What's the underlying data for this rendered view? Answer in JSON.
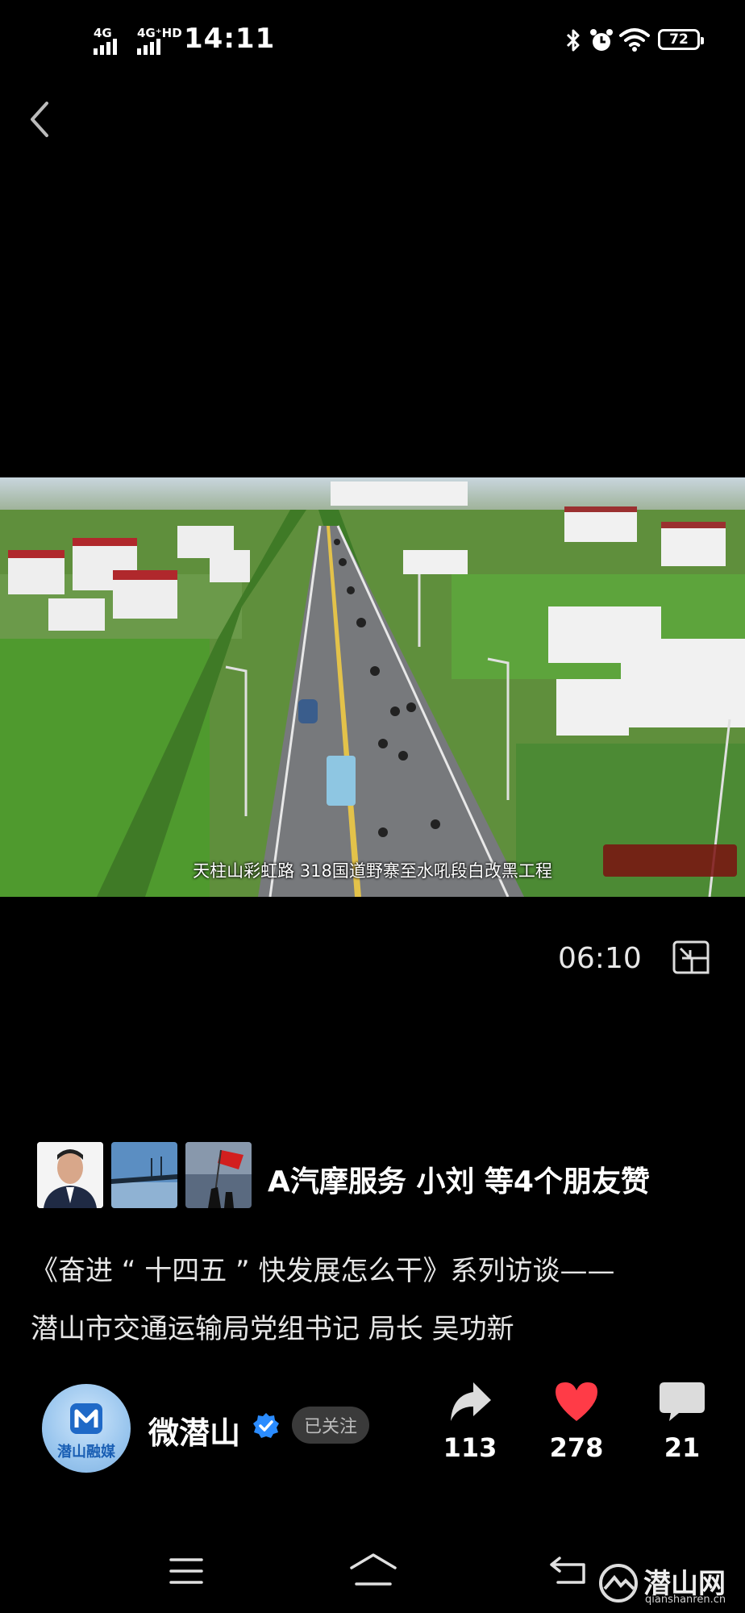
{
  "status_bar": {
    "signal1_label": "4G",
    "signal2_label": "4G⁺HD",
    "time": "14:11",
    "battery": "72"
  },
  "video": {
    "subtitle": "天柱山彩虹路   318国道野寨至水吼段白改黑工程",
    "duration": "06:10"
  },
  "likes": {
    "text": "A汽摩服务  小刘  等4个朋友赞"
  },
  "post": {
    "title_line1": "《奋进 “ 十四五 ” 快发展怎么干》系列访谈——",
    "title_line2": "潜山市交通运输局党组书记 局长 吴功新"
  },
  "author": {
    "avatar_text": "潜山融媒",
    "name": "微潜山",
    "follow_label": "已关注"
  },
  "actions": {
    "share_count": "113",
    "like_count": "278",
    "comment_count": "21"
  },
  "watermark": {
    "text": "潜山网",
    "url": "qianshanren.cn"
  },
  "colors": {
    "like_red": "#ff3b47",
    "verified_blue": "#2b8cff"
  }
}
